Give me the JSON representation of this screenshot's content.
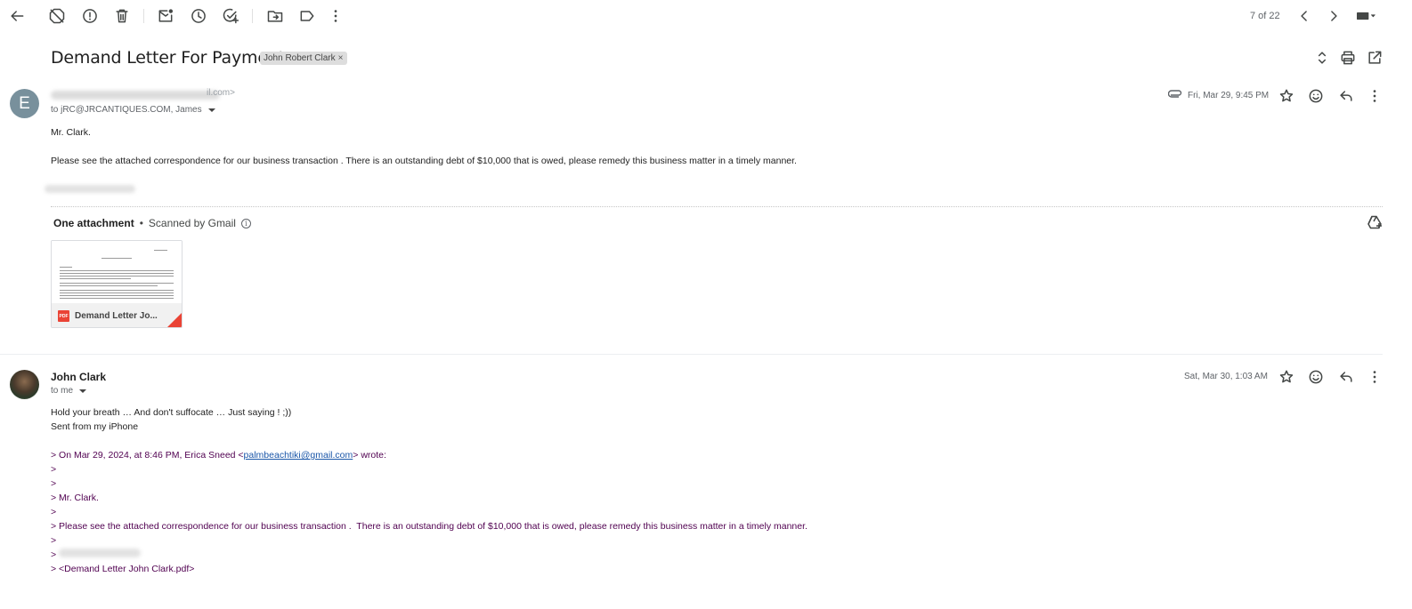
{
  "toolbar": {
    "icons": [
      "back-arrow-icon",
      "report-spam-off-icon",
      "report-icon",
      "delete-icon",
      "mark-unread-icon",
      "snooze-icon",
      "add-task-icon",
      "move-to-icon",
      "label-icon",
      "more-vert-icon"
    ],
    "pager_text": "7 of 22",
    "nav_icons": [
      "chevron-left-icon",
      "chevron-right-icon",
      "keyboard-icon"
    ]
  },
  "thread": {
    "subject": "Demand Letter For Payment",
    "label": "John Robert Clark",
    "label_remove": "×",
    "header_icons": [
      "expand-collapse-icon",
      "print-icon",
      "open-new-window-icon"
    ]
  },
  "message1": {
    "avatar_letter": "E",
    "sender_partial": "il.com>",
    "recipients": "to jRC@JRCANTIQUES.COM, James",
    "date": "Fri, Mar 29, 9:45 PM",
    "greeting": "Mr. Clark.",
    "body": "Please see the attached correspondence for our business transaction .  There is an outstanding debt of $10,000 that is owed, please remedy this business matter in a timely manner.",
    "attachment_heading": "One attachment",
    "attachment_sep": "•",
    "scanned_text": "Scanned by Gmail",
    "info_glyph": "i",
    "attachment_name": "Demand Letter Jo...",
    "pdf_badge": "PDF"
  },
  "message2": {
    "sender": "John Clark",
    "recipients": "to me",
    "date": "Sat, Mar 30, 1:03 AM",
    "line1": "Hold your breath … And don't suffocate … Just saying ! ;))",
    "line2": "Sent from my iPhone",
    "quote_intro_before": "> On Mar 29, 2024, at 8:46 PM, Erica Sneed <",
    "quote_email": "palmbeachtiki@gmail.com",
    "quote_intro_after": "> wrote:",
    "quote_marker": ">",
    "quote_greeting": "> Mr. Clark.",
    "quote_body": "> Please see the attached correspondence for our business transaction .  There is an outstanding debt of $10,000 that is owed, please remedy this business matter in a timely manner.",
    "quote_attachment": "> <Demand Letter John Clark.pdf>"
  },
  "colors": {
    "avatar_bg": "#78909c",
    "quote_text": "#500050",
    "link": "#1a56a8",
    "pdf_red": "#ea4335"
  }
}
